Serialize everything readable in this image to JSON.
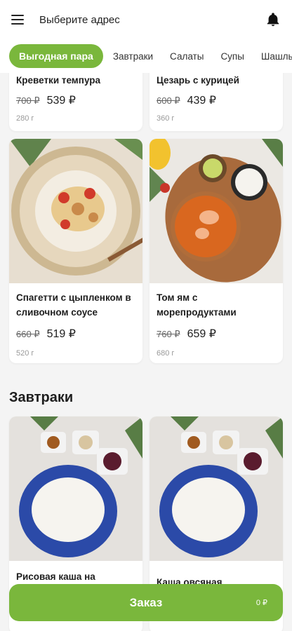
{
  "header": {
    "address_label": "Выберите адрес"
  },
  "tabs": [
    {
      "label": "Выгодная пара"
    },
    {
      "label": "Завтраки"
    },
    {
      "label": "Салаты"
    },
    {
      "label": "Супы"
    },
    {
      "label": "Шашлыки"
    }
  ],
  "top_cards": [
    {
      "name": "Креветки темпура",
      "old_price": "700 ₽",
      "price": "539 ₽",
      "weight": "280 г"
    },
    {
      "name": "Цезарь с курицей",
      "old_price": "600 ₽",
      "price": "439 ₽",
      "weight": "360 г"
    }
  ],
  "cards": [
    {
      "name": "Спагетти с цыпленком в сливочном соусе",
      "old_price": "660 ₽",
      "price": "519 ₽",
      "weight": "520 г"
    },
    {
      "name": "Том ям с морепродуктами",
      "old_price": "760 ₽",
      "price": "659 ₽",
      "weight": "680 г"
    }
  ],
  "breakfast": {
    "title": "Завтраки",
    "items": [
      {
        "name": "Рисовая каша на"
      },
      {
        "name": "Каша овсяная"
      }
    ]
  },
  "order": {
    "label": "Заказ",
    "sum": "0 ₽"
  },
  "colors": {
    "accent": "#7ab73c"
  }
}
